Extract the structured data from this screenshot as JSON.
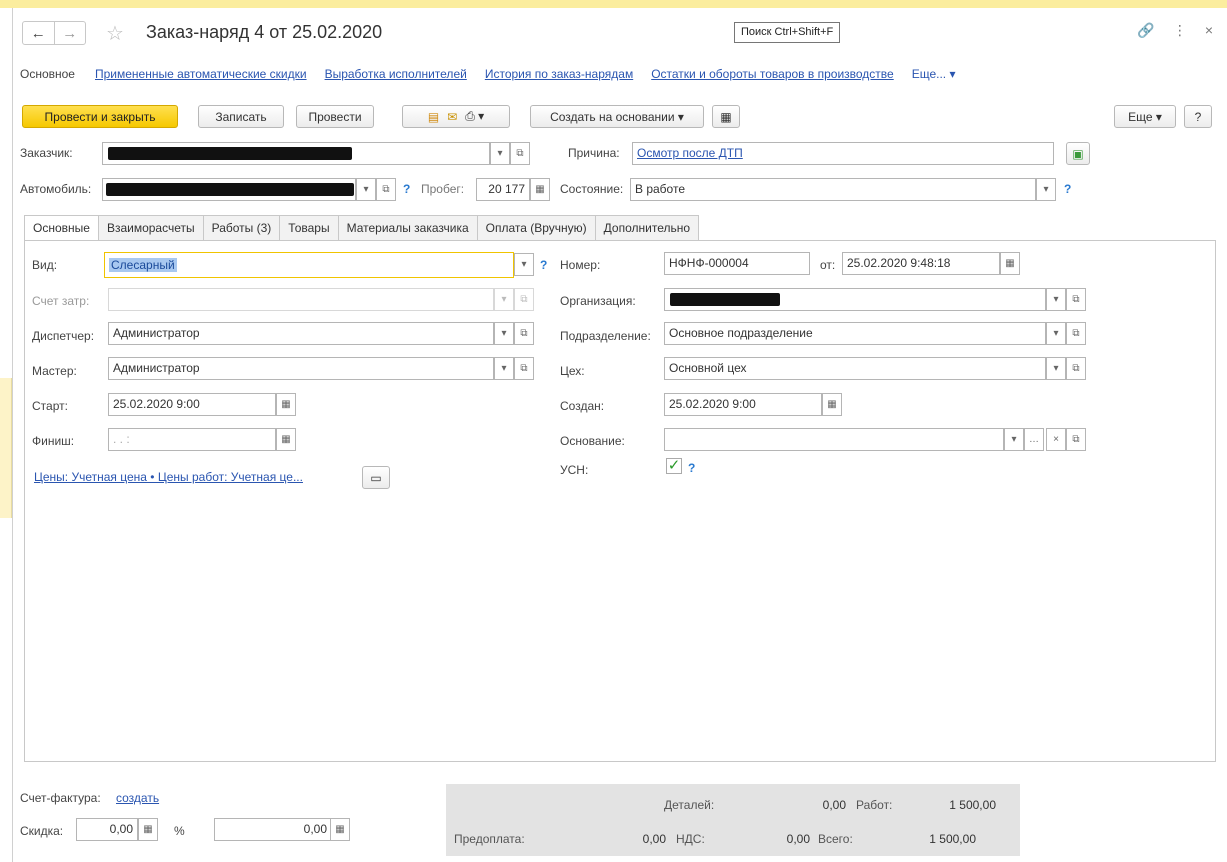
{
  "window": {
    "title": "Заказ-наряд 4 от 25.02.2020",
    "search_tooltip": "Поиск Ctrl+Shift+F"
  },
  "nav_links": {
    "active": "Основное",
    "items": [
      "Примененные автоматические скидки",
      "Выработка исполнителей",
      "История по заказ-нарядам",
      "Остатки и обороты товаров в производстве"
    ],
    "more": "Еще... ▾"
  },
  "toolbar": {
    "post_close": "Провести и закрыть",
    "save": "Записать",
    "post": "Провести",
    "create_based": "Создать на основании",
    "more": "Еще",
    "help": "?"
  },
  "header": {
    "customer_label": "Заказчик:",
    "car_label": "Автомобиль:",
    "mileage_label": "Пробег:",
    "mileage_value": "20 177",
    "reason_label": "Причина:",
    "reason_value": "Осмотр после ДТП",
    "state_label": "Состояние:",
    "state_value": "В работе"
  },
  "tabs": [
    "Основные",
    "Взаиморасчеты",
    "Работы (3)",
    "Товары",
    "Материалы заказчика",
    "Оплата (Вручную)",
    "Дополнительно"
  ],
  "main": {
    "kind_label": "Вид:",
    "kind_value": "Слесарный",
    "cost_account_label": "Счет затр:",
    "dispatcher_label": "Диспетчер:",
    "dispatcher_value": "Администратор",
    "master_label": "Мастер:",
    "master_value": "Администратор",
    "start_label": "Старт:",
    "start_value": "25.02.2020  9:00",
    "finish_label": "Финиш:",
    "finish_value": ".   .       :",
    "prices_link": "Цены: Учетная цена • Цены работ: Учетная це...",
    "number_label": "Номер:",
    "number_value": "НФНФ-000004",
    "from_label": "от:",
    "from_value": "25.02.2020  9:48:18",
    "org_label": "Организация:",
    "division_label": "Подразделение:",
    "division_value": "Основное подразделение",
    "workshop_label": "Цех:",
    "workshop_value": "Основной цех",
    "created_label": "Создан:",
    "created_value": "25.02.2020  9:00",
    "basis_label": "Основание:",
    "usn_label": "УСН:"
  },
  "footer": {
    "invoice_label": "Счет-фактура:",
    "invoice_link": "создать",
    "discount_label": "Скидка:",
    "discount_value": "0,00",
    "percent": "%",
    "discount_sum": "0,00",
    "parts_label": "Деталей:",
    "parts_value": "0,00",
    "works_label": "Работ:",
    "works_value": "1 500,00",
    "prepay_label": "Предоплата:",
    "prepay_value": "0,00",
    "vat_label": "НДС:",
    "vat_value": "0,00",
    "total_label": "Всего:",
    "total_value": "1 500,00"
  }
}
